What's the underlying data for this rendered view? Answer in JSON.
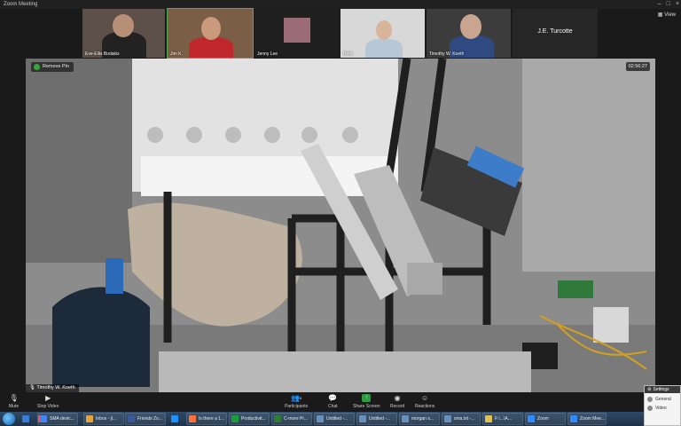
{
  "window": {
    "title": "Zoom Meeting",
    "controls": [
      "–",
      "□",
      "×"
    ]
  },
  "gallery": {
    "view_label": "View",
    "participants": [
      {
        "name": "Eve-Ellis Bodakis"
      },
      {
        "name": "Jim K."
      },
      {
        "name": "Jenny Lee"
      },
      {
        "name": "Beth"
      },
      {
        "name": "Timothy W. Koeth"
      },
      {
        "name": "J.E. Turcotte"
      }
    ]
  },
  "main_video": {
    "remove_pin_label": "Remove Pin",
    "timer": "02:56:27",
    "speaker_name": "Timothy W. Koeth"
  },
  "toolbar": {
    "buttons": [
      {
        "label": "Mute",
        "icon": "microphone-icon"
      },
      {
        "label": "Stop Video",
        "icon": "video-camera-icon"
      },
      {
        "label": "Participants",
        "count": "8",
        "icon": "participants-icon"
      },
      {
        "label": "Chat",
        "icon": "chat-icon"
      },
      {
        "label": "Share Screen",
        "icon": "share-screen-icon"
      },
      {
        "label": "Record",
        "icon": "record-icon"
      },
      {
        "label": "Reactions",
        "icon": "reactions-icon"
      }
    ]
  },
  "taskbar": {
    "items": [
      {
        "label": "",
        "color": "#3a7bd5"
      },
      {
        "label": "",
        "color": "#e24a4a"
      },
      {
        "label": "SMA devic...",
        "color": "#4285f4"
      },
      {
        "label": "Inbox - jl...",
        "color": "#e8a33c"
      },
      {
        "label": "Friends Zo...",
        "color": "#3b5998"
      },
      {
        "label": "",
        "color": "#1e90ff"
      },
      {
        "label": "Is there a 1...",
        "color": "#ff7139"
      },
      {
        "label": "Productivit...",
        "color": "#1a9e3a"
      },
      {
        "label": "C-more Pr...",
        "color": "#2e7d32"
      },
      {
        "label": "Untitled -...",
        "color": "#6b8fb8"
      },
      {
        "label": "Untitled -...",
        "color": "#6b8fb8"
      },
      {
        "label": "morgan s...",
        "color": "#6b8fb8"
      },
      {
        "label": "sma.txt -...",
        "color": "#6b8fb8"
      },
      {
        "label": "F:\\...\\A...",
        "color": "#e0c050"
      },
      {
        "label": "Zoom",
        "color": "#2d8cff"
      },
      {
        "label": "Zoom Mee...",
        "color": "#2d8cff"
      }
    ]
  },
  "settings_popup": {
    "title": "Settings",
    "items": [
      "General",
      "Video"
    ]
  }
}
